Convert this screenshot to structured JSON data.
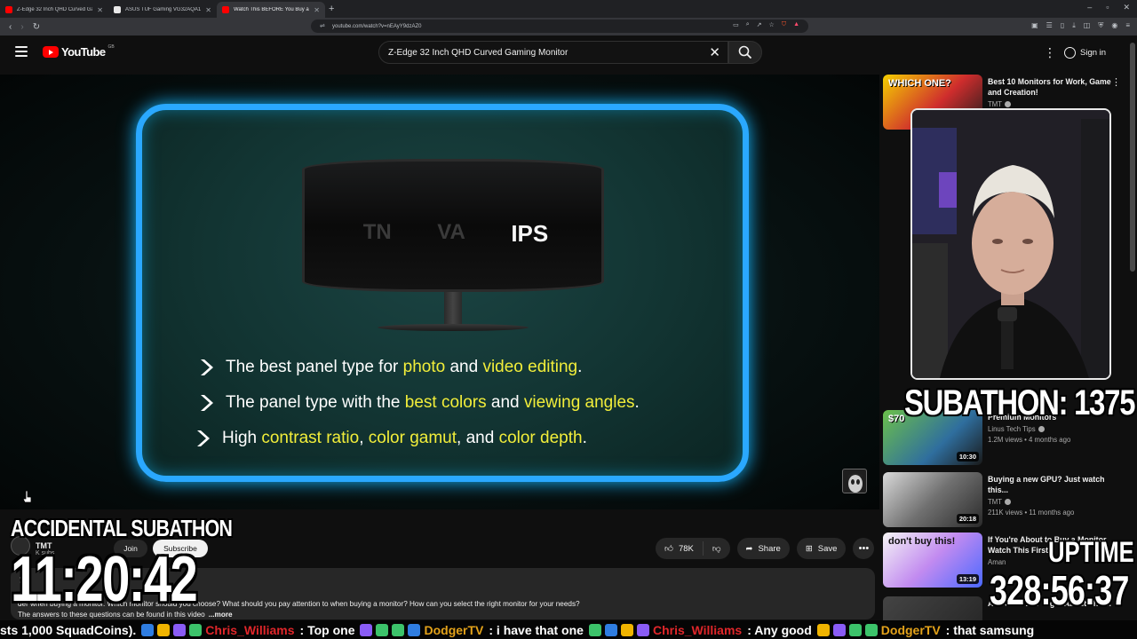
{
  "browser": {
    "tabs": [
      {
        "title": "Z-Edge 32 Inch QHD Curved Gaming",
        "active": false,
        "favicon_color": "#ff0000"
      },
      {
        "title": "ASUS TUF Gaming VG32AQA1A - 31",
        "active": false,
        "favicon_color": "#e8e8e8"
      },
      {
        "title": "Watch This BEFORE You Buy a",
        "active": true,
        "favicon_color": "#ff0000"
      }
    ],
    "url": "youtube.com/watch?v=nEAyY9dzAZ0"
  },
  "youtube": {
    "logo_text": "YouTube",
    "region": "GB",
    "search_value": "Z-Edge 32 Inch QHD Curved Gaming Monitor",
    "sign_in": "Sign in"
  },
  "video": {
    "panel_types": [
      "TN",
      "VA",
      "IPS"
    ],
    "bullets": [
      [
        {
          "t": "The best panel type for ",
          "h": false
        },
        {
          "t": "photo",
          "h": true
        },
        {
          "t": " and ",
          "h": false
        },
        {
          "t": "video editing",
          "h": true
        },
        {
          "t": ".",
          "h": false
        }
      ],
      [
        {
          "t": "The panel type with the ",
          "h": false
        },
        {
          "t": "best colors",
          "h": true
        },
        {
          "t": " and ",
          "h": false
        },
        {
          "t": "viewing angles",
          "h": true
        },
        {
          "t": ".",
          "h": false
        }
      ],
      [
        {
          "t": "High ",
          "h": false
        },
        {
          "t": "contrast ratio",
          "h": true
        },
        {
          "t": ", ",
          "h": false
        },
        {
          "t": "color gamut",
          "h": true
        },
        {
          "t": ", and ",
          "h": false
        },
        {
          "t": "color depth",
          "h": true
        },
        {
          "t": ".",
          "h": false
        }
      ]
    ],
    "highlight_color": "#f2ee3a",
    "border_color": "#2aa8ff"
  },
  "meta": {
    "channel": "TMT",
    "subs": "K subs",
    "join": "Join",
    "subscribe": "Subscribe",
    "likes": "78K",
    "share": "Share",
    "save": "Save",
    "views": "ye",
    "desc_line1": "der when buying a monitor. Which monitor should you choose? What should you pay attention to when buying a monitor? How can you select the right monitor for your needs?",
    "desc_line2": "The answers to these questions can be found in this video",
    "more": "...more"
  },
  "sidebar": [
    {
      "title": "Best 10 Monitors for Work, Game and Creation!",
      "channel": "TMT",
      "stats": "",
      "duration": "",
      "thumb_text": "WHICH ONE?"
    },
    {
      "title": "Premium Monitors",
      "channel": "Linus Tech Tips",
      "stats": "1.2M views • 4 months ago",
      "duration": "10:30",
      "thumb_text": "$70"
    },
    {
      "title": "Buying a new GPU? Just watch this...",
      "channel": "TMT",
      "stats": "211K views • 11 months ago",
      "duration": "20:18",
      "thumb_text": ""
    },
    {
      "title": "If You're About to Buy a Monitor, Watch This First",
      "channel": "Aman",
      "stats": "",
      "duration": "13:19",
      "thumb_text": "don't buy this!"
    },
    {
      "title": "ABSOLUTELY Right About The ...",
      "channel": "",
      "stats": "",
      "duration": "",
      "thumb_text": ""
    }
  ],
  "overlays": {
    "subathon": "SUBATHON: 1375",
    "accidental_label": "ACCIDENTAL SUBATHON",
    "accidental_timer": "11:20:42",
    "uptime_label": "UPTIME",
    "uptime_value": "328:56:37"
  },
  "ticker": [
    {
      "kind": "text",
      "t": "sts 1,000 SquadCoins)."
    },
    {
      "kind": "user",
      "color": "red",
      "t": "Chris_Williams"
    },
    {
      "kind": "text",
      "t": ": Top one"
    },
    {
      "kind": "user",
      "color": "gold",
      "t": "DodgerTV"
    },
    {
      "kind": "text",
      "t": ": i have that one"
    },
    {
      "kind": "user",
      "color": "red",
      "t": "Chris_Williams"
    },
    {
      "kind": "text",
      "t": ": Any good"
    },
    {
      "kind": "user",
      "color": "gold",
      "t": "DodgerTV"
    },
    {
      "kind": "text",
      "t": ": that samsung"
    }
  ]
}
